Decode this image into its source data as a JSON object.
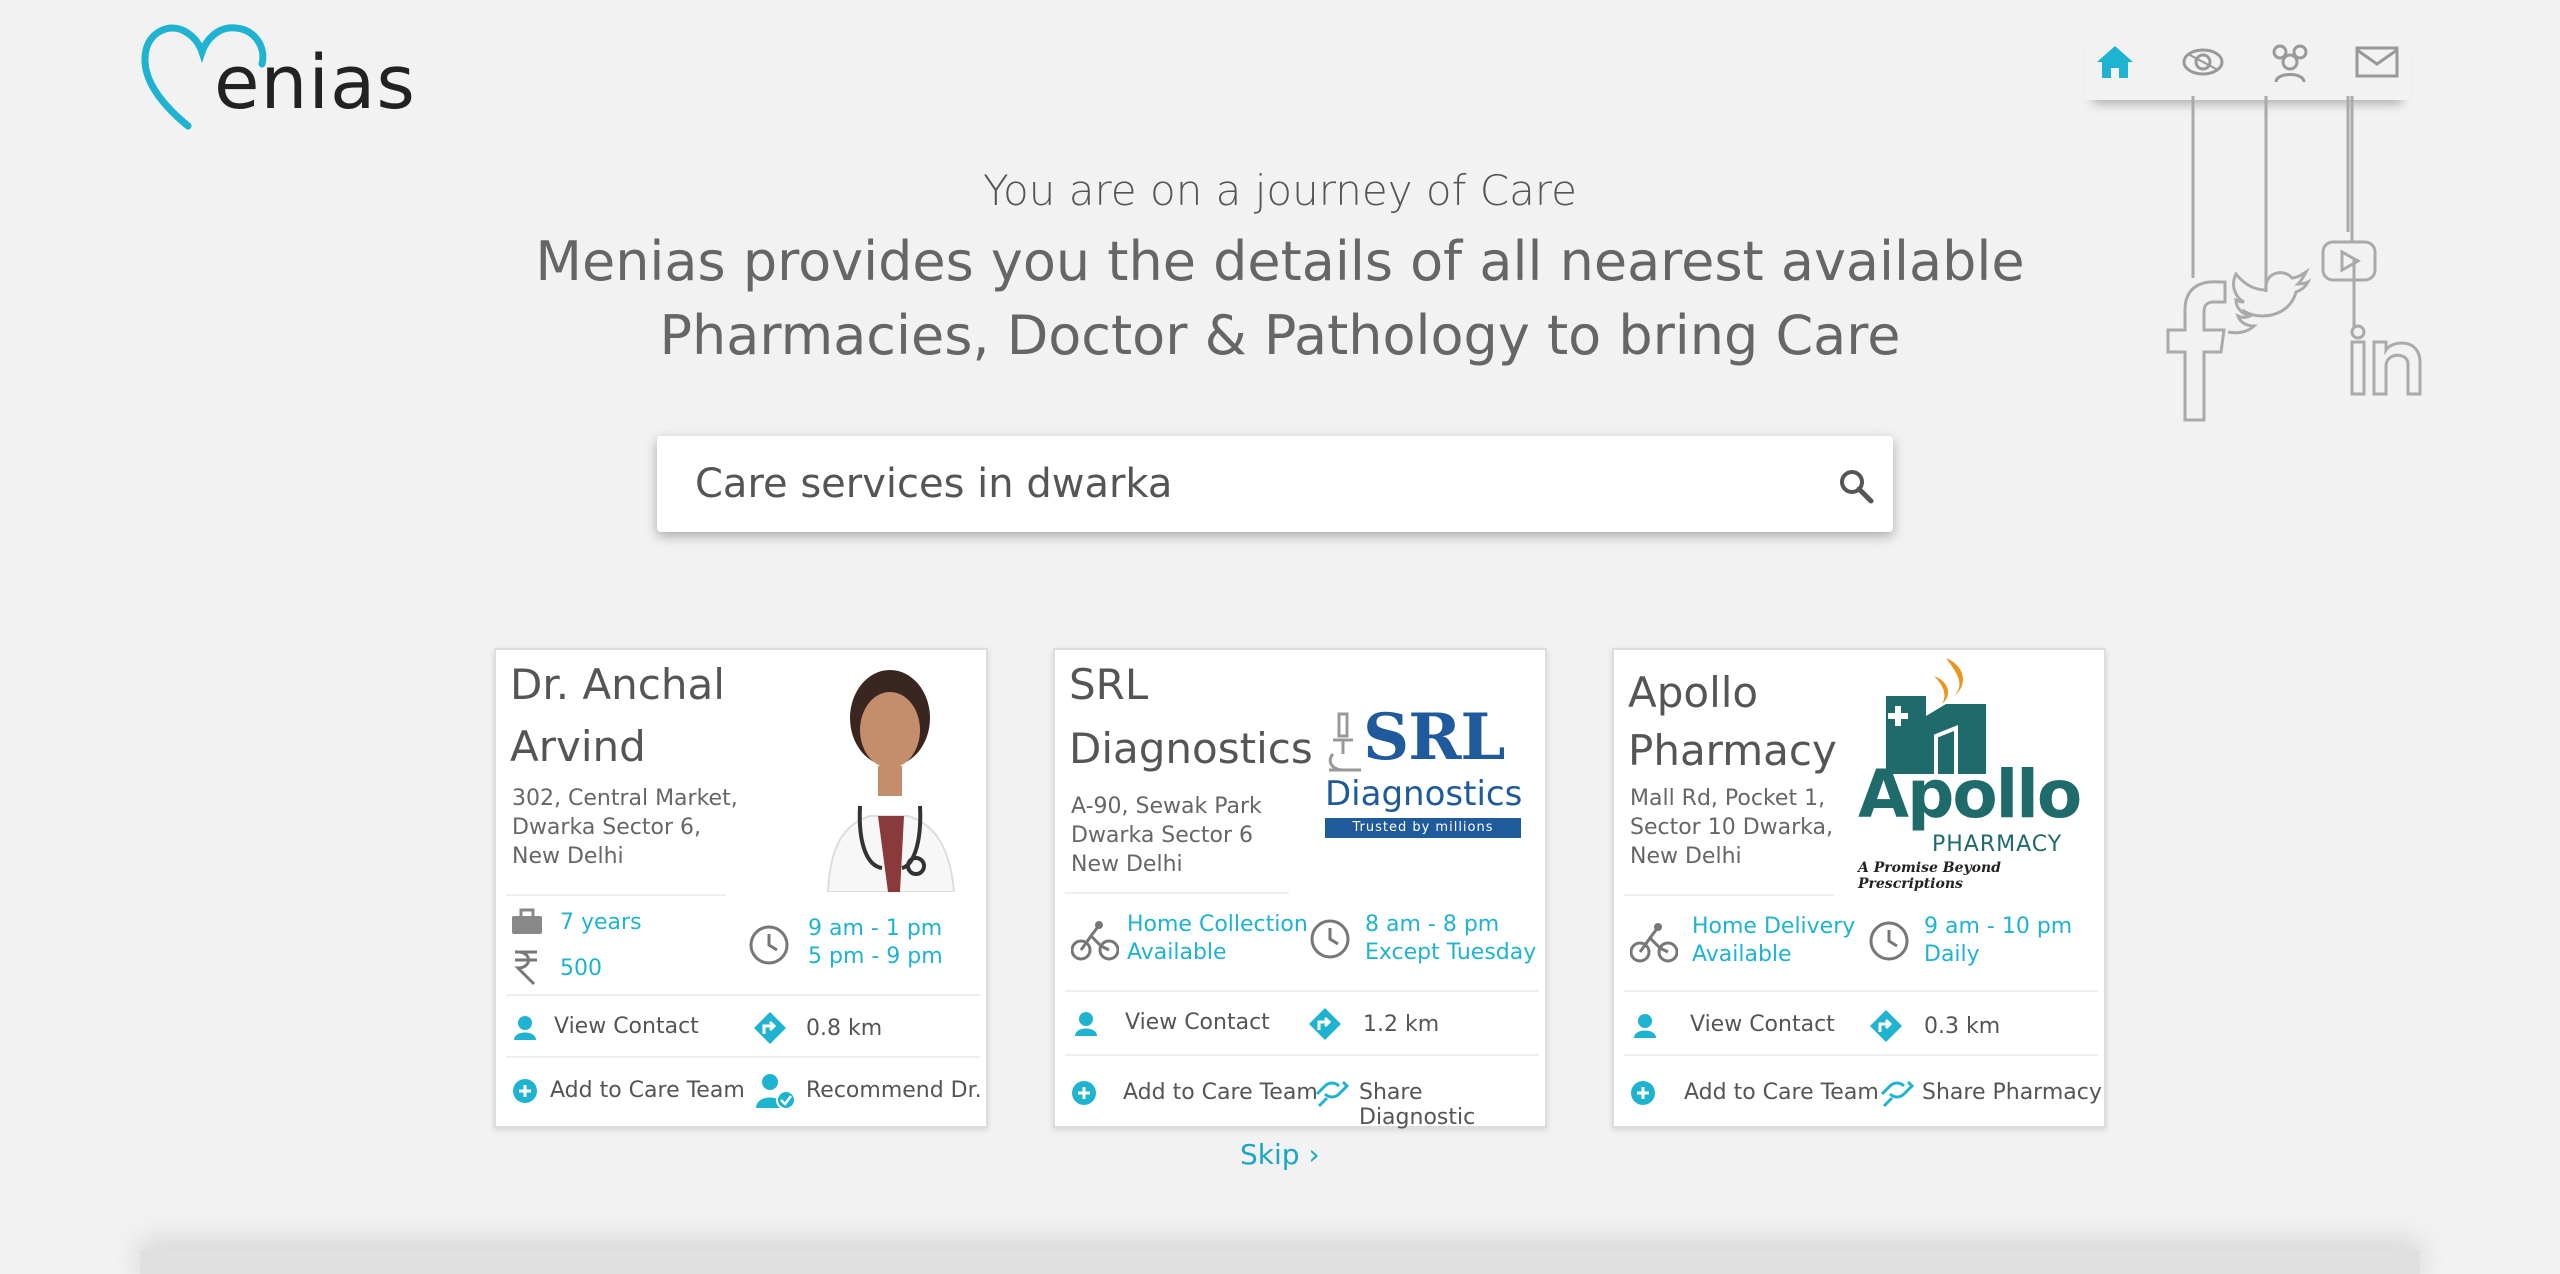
{
  "brand": {
    "name": "enias",
    "accent": "#1fb3d2"
  },
  "nav": {
    "items": [
      "home-icon",
      "eye-icon",
      "group-icon",
      "mail-icon"
    ]
  },
  "social": {
    "items": [
      "facebook-icon",
      "twitter-icon",
      "youtube-icon",
      "linkedin-icon"
    ]
  },
  "hero": {
    "tagline": "You are on a journey of Care",
    "line1": "Menias provides you the details of all nearest available",
    "line2": "Pharmacies, Doctor & Pathology to bring Care"
  },
  "search": {
    "value": "Care services in dwarka"
  },
  "cards": [
    {
      "title1": "Dr. Anchal",
      "title2": "Arvind",
      "addr1": "302, Central Market,",
      "addr2": "Dwarka Sector 6,",
      "addr3": "New Delhi",
      "experience": "7 years",
      "fee": "500",
      "hours1": "9 am - 1 pm",
      "hours2": "5 pm - 9 pm",
      "contact": "View Contact",
      "distance": "0.8 km",
      "add": "Add to Care Team",
      "action": "Recommend Dr."
    },
    {
      "title1": "SRL",
      "title2": "Diagnostics",
      "addr1": "A-90, Sewak Park",
      "addr2": "Dwarka Sector 6",
      "addr3": "New Delhi",
      "service1": "Home Collection",
      "service2": "Available",
      "hours1": "8 am - 8 pm",
      "hours2": "Except Tuesday",
      "contact": "View Contact",
      "distance": "1.2 km",
      "add": "Add to Care Team",
      "action": "Share Diagnostic",
      "logo_main": "SRL",
      "logo_sub": "Diagnostics",
      "logo_strip": "Trusted by millions"
    },
    {
      "title1": "Apollo",
      "title2": "Pharmacy",
      "addr1": "Mall Rd, Pocket 1,",
      "addr2": "Sector 10 Dwarka,",
      "addr3": "New Delhi",
      "service1": "Home Delivery",
      "service2": "Available",
      "hours1": "9 am - 10 pm",
      "hours2": "Daily",
      "contact": "View Contact",
      "distance": "0.3 km",
      "add": "Add to Care Team",
      "action": "Share Pharmacy",
      "logo_main": "Apollo",
      "logo_sub": "PHARMACY",
      "logo_tag": "A Promise Beyond Prescriptions"
    }
  ],
  "skip": {
    "label": "Skip ›"
  }
}
